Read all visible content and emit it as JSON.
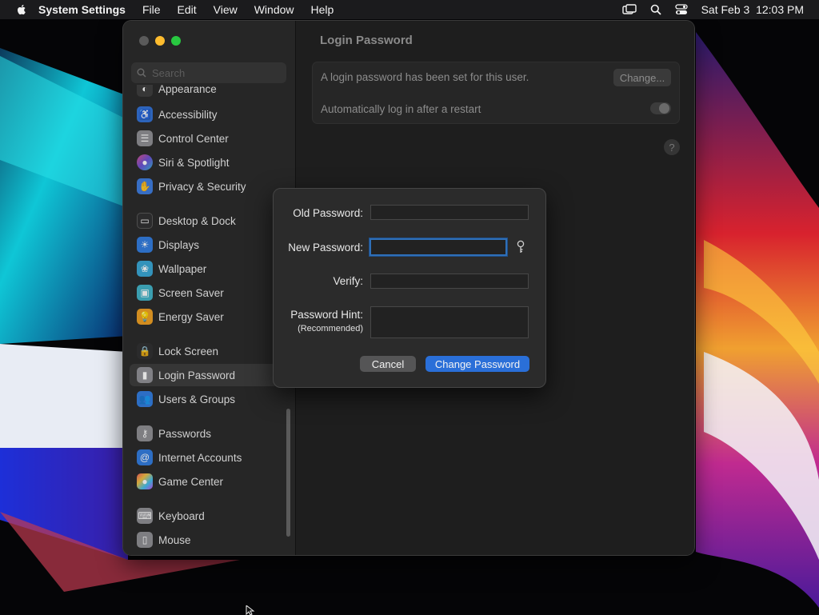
{
  "menubar": {
    "app_name": "System Settings",
    "menus": [
      "File",
      "Edit",
      "View",
      "Window",
      "Help"
    ],
    "datetime": "Sat Feb 3  12:03 PM",
    "status_icons": [
      "screen-mirroring-icon",
      "search-icon",
      "control-center-icon"
    ]
  },
  "sidebar": {
    "search_placeholder": "Search",
    "items": [
      {
        "label": "Appearance",
        "icon": "appearance-icon",
        "color": "#3a3a3a"
      },
      {
        "label": "Accessibility",
        "icon": "accessibility-icon",
        "color": "#2f6fd6"
      },
      {
        "label": "Control Center",
        "icon": "control-center-icon",
        "color": "#8e8e93"
      },
      {
        "label": "Siri & Spotlight",
        "icon": "siri-icon",
        "color": "#b04fd6"
      },
      {
        "label": "Privacy & Security",
        "icon": "hand-icon",
        "color": "#3b7be0"
      },
      {
        "label": "Desktop & Dock",
        "icon": "dock-icon",
        "color": "#2c2c2e"
      },
      {
        "label": "Displays",
        "icon": "displays-icon",
        "color": "#2f7be0"
      },
      {
        "label": "Wallpaper",
        "icon": "wallpaper-icon",
        "color": "#36a7d6"
      },
      {
        "label": "Screen Saver",
        "icon": "screen-saver-icon",
        "color": "#3fb4c9"
      },
      {
        "label": "Energy Saver",
        "icon": "energy-saver-icon",
        "color": "#f0a020"
      },
      {
        "label": "Lock Screen",
        "icon": "lock-icon",
        "color": "#2c2c2e"
      },
      {
        "label": "Login Password",
        "icon": "login-password-icon",
        "color": "#8e8e93"
      },
      {
        "label": "Users & Groups",
        "icon": "users-icon",
        "color": "#2f7be0"
      },
      {
        "label": "Passwords",
        "icon": "key-icon",
        "color": "#8e8e93"
      },
      {
        "label": "Internet Accounts",
        "icon": "at-icon",
        "color": "#2f7be0"
      },
      {
        "label": "Game Center",
        "icon": "game-center-icon",
        "color": "#e05a8a"
      },
      {
        "label": "Keyboard",
        "icon": "keyboard-icon",
        "color": "#8e8e93"
      },
      {
        "label": "Mouse",
        "icon": "mouse-icon",
        "color": "#8e8e93"
      }
    ],
    "selected": "Login Password"
  },
  "content": {
    "title": "Login Password",
    "password_set_text": "A login password has been set for this user.",
    "change_button": "Change...",
    "auto_login_label": "Automatically log in after a restart",
    "auto_login_enabled": false,
    "help_glyph": "?"
  },
  "dialog": {
    "old_password_label": "Old Password:",
    "old_password_value": "",
    "new_password_label": "New Password:",
    "new_password_value": "",
    "verify_label": "Verify:",
    "verify_value": "",
    "hint_label": "Password Hint:",
    "hint_sublabel": "(Recommended)",
    "hint_value": "",
    "cancel_button": "Cancel",
    "confirm_button": "Change Password"
  },
  "colors": {
    "accent": "#2a6fd8",
    "traffic_close": "#5a5a5a",
    "traffic_minimize": "#febc2e",
    "traffic_zoom": "#28c840"
  }
}
